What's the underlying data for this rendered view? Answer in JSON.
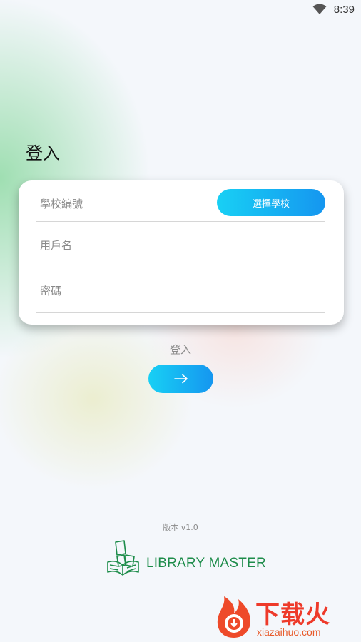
{
  "status_bar": {
    "time": "8:39",
    "wifi_icon": "wifi-icon"
  },
  "page_title": "登入",
  "form": {
    "school_id_placeholder": "學校編號",
    "select_school_button": "選擇學校",
    "username_placeholder": "用戶名",
    "password_placeholder": "密碼"
  },
  "login_label": "登入",
  "submit_icon": "arrow-right-icon",
  "version_text": "版本 v1.0",
  "brand_name": "LIBRARY MASTER",
  "watermark": {
    "title": "下载火",
    "url": "xiazaihuo.com"
  },
  "colors": {
    "accent_start": "#18d0f4",
    "accent_end": "#1596f0",
    "brand_green": "#1d8c4a",
    "watermark_red": "#ee3a2a"
  }
}
